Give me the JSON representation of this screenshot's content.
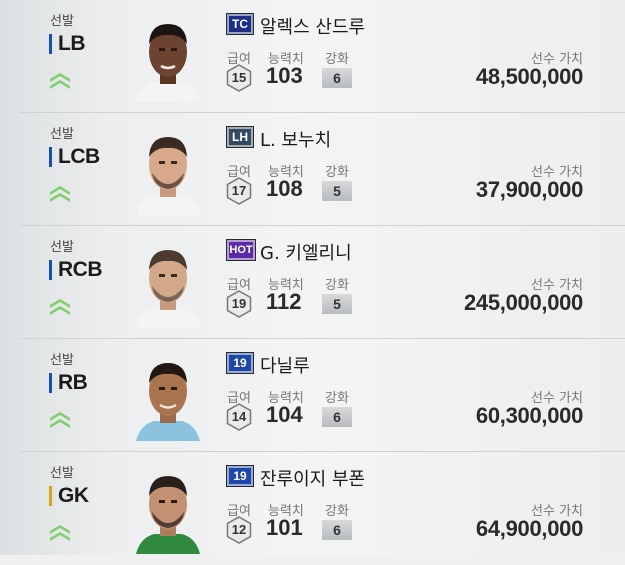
{
  "labels": {
    "selected": "선발",
    "salary": "급여",
    "ability": "능력치",
    "enhance": "강화",
    "value": "선수 가치"
  },
  "colors": {
    "defender": "#1a4fb0",
    "goalkeeper": "#d8a514",
    "chevron": "#7fcf6f",
    "badge_tc": "#1b2f86",
    "badge_lh": "#324a62",
    "badge_hot": "#5b2aa6",
    "badge_19": "#1f46a8"
  },
  "players": [
    {
      "position": "LB",
      "badge": "TC",
      "name": "알렉스 산드루",
      "salary": "15",
      "ability": "103",
      "enhance": "6",
      "value": "48,500,000",
      "pos_group": "defender",
      "portrait": "player-portrait"
    },
    {
      "position": "LCB",
      "badge": "LH",
      "name": "L. 보누치",
      "salary": "17",
      "ability": "108",
      "enhance": "5",
      "value": "37,900,000",
      "pos_group": "defender",
      "portrait": "player-portrait"
    },
    {
      "position": "RCB",
      "badge": "HOT",
      "name": "G. 키엘리니",
      "salary": "19",
      "ability": "112",
      "enhance": "5",
      "value": "245,000,000",
      "pos_group": "defender",
      "portrait": "player-portrait"
    },
    {
      "position": "RB",
      "badge": "19",
      "name": "다닐루",
      "salary": "14",
      "ability": "104",
      "enhance": "6",
      "value": "60,300,000",
      "pos_group": "defender",
      "portrait": "player-portrait"
    },
    {
      "position": "GK",
      "badge": "19",
      "name": "잔루이지 부폰",
      "salary": "12",
      "ability": "101",
      "enhance": "6",
      "value": "64,900,000",
      "pos_group": "goalkeeper",
      "portrait": "player-portrait"
    }
  ]
}
